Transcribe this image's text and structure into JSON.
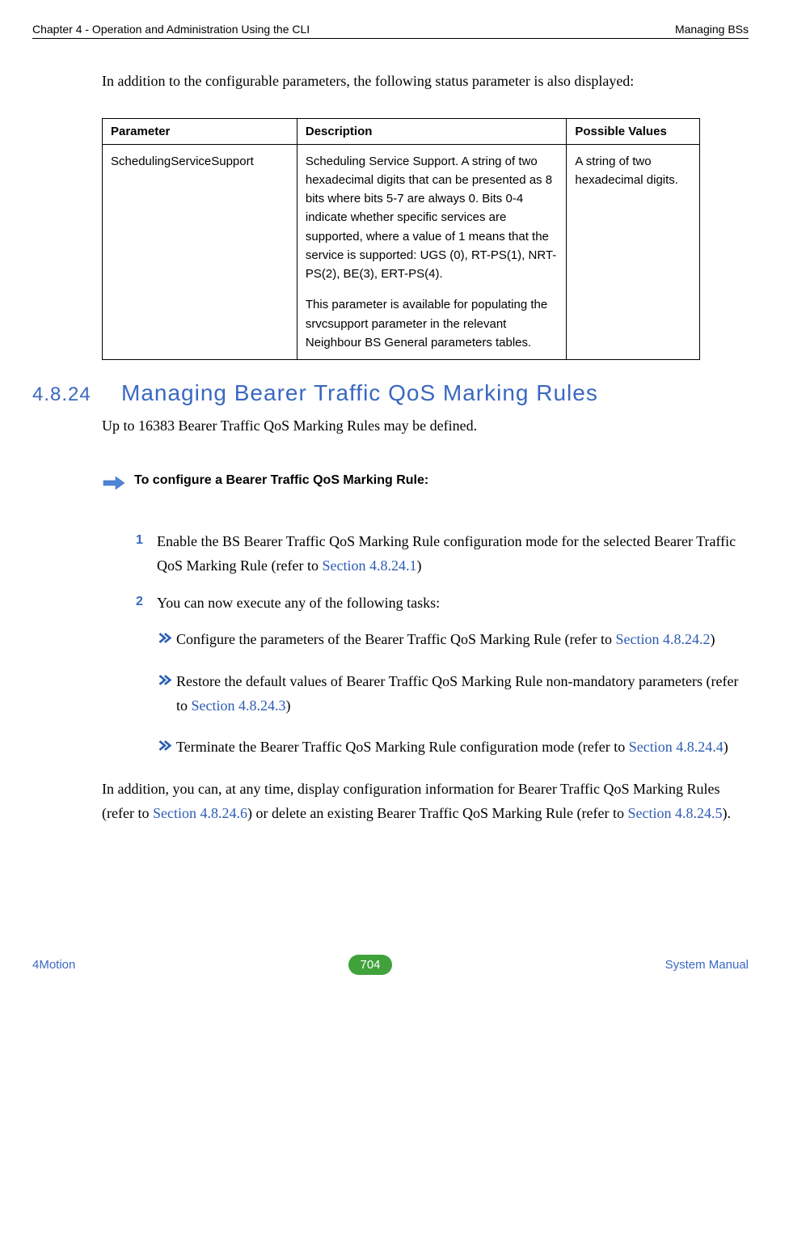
{
  "header": {
    "left": "Chapter 4 - Operation and Administration Using the CLI",
    "right": "Managing BSs"
  },
  "intro": "In addition to the configurable parameters, the following status parameter is also displayed:",
  "table": {
    "headers": {
      "param": "Parameter",
      "desc": "Description",
      "vals": "Possible Values"
    },
    "row": {
      "param": "SchedulingServiceSupport",
      "desc1": "Scheduling Service Support. A string of two hexadecimal digits that can be presented as 8 bits where bits 5-7 are always 0. Bits 0-4 indicate whether specific services are supported, where a value of 1 means that the service is supported: UGS (0), RT-PS(1), NRT-PS(2), BE(3), ERT-PS(4).",
      "desc2": "This parameter is available for populating the srvcsupport parameter in the relevant Neighbour BS General parameters tables.",
      "vals": "A string of two hexadecimal digits."
    }
  },
  "section": {
    "num": "4.8.24",
    "title": "Managing Bearer Traffic QoS Marking Rules",
    "body": "Up to 16383 Bearer Traffic QoS Marking Rules may be defined."
  },
  "configure": "To configure a Bearer Traffic QoS Marking Rule:",
  "steps": {
    "s1": {
      "num": "1",
      "pre": "Enable the BS Bearer Traffic QoS Marking Rule configuration mode for the selected Bearer Traffic QoS Marking Rule (refer to ",
      "link": "Section 4.8.24.1",
      "post": ")"
    },
    "s2": {
      "num": "2",
      "text": "You can now execute any of the following tasks:"
    }
  },
  "subs": {
    "a": {
      "pre": "Configure the parameters of the Bearer Traffic QoS Marking Rule (refer to ",
      "link": "Section 4.8.24.2",
      "post": ")"
    },
    "b": {
      "pre": "Restore the default values of Bearer Traffic QoS Marking Rule non-mandatory parameters (refer to ",
      "link": "Section 4.8.24.3",
      "post": ")"
    },
    "c": {
      "pre": " Terminate the Bearer Traffic QoS Marking Rule configuration mode (refer to ",
      "link": "Section 4.8.24.4",
      "post": ")"
    }
  },
  "closing": {
    "p1": "In addition, you can, at any time, display configuration information for Bearer Traffic QoS Marking Rules (refer to ",
    "l1": "Section 4.8.24.6",
    "p2": ") or delete an existing Bearer Traffic QoS Marking Rule (refer to ",
    "l2": "Section 4.8.24.5",
    "p3": ")."
  },
  "footer": {
    "left": "4Motion",
    "page": "704",
    "right": "System Manual"
  }
}
